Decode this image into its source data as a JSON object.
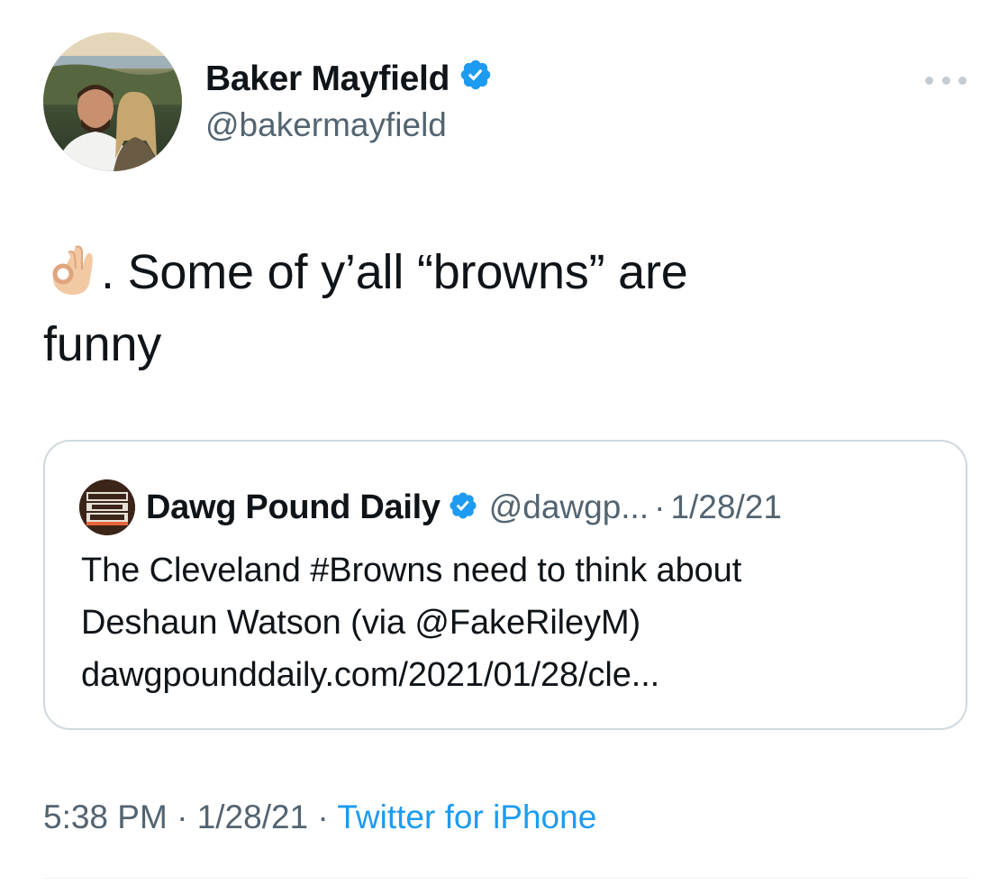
{
  "author": {
    "name": "Baker Mayfield",
    "handle": "@bakermayfield",
    "verified_icon": "verified-badge-icon",
    "verified_color": "#1d9bf0"
  },
  "more_icon": "more-horizontal-icon",
  "tweet": {
    "emoji": "ok-hand-emoji-icon",
    "text_line1": ". Some of y’all “browns” are",
    "text_line2": "funny"
  },
  "quoted_tweet": {
    "author_name": "Dawg Pound Daily",
    "verified_icon": "verified-badge-icon",
    "handle": "@dawgp...",
    "separator": "·",
    "date": "1/28/21",
    "body_line1": "The Cleveland #Browns need to think about",
    "body_line2": "Deshaun Watson (via @FakeRileyM)",
    "body_line3": "dawgpounddaily.com/2021/01/28/cle..."
  },
  "meta": {
    "time": "5:38 PM",
    "separator": "·",
    "date": "1/28/21",
    "source": "Twitter for iPhone",
    "source_color": "#1d9bf0"
  }
}
